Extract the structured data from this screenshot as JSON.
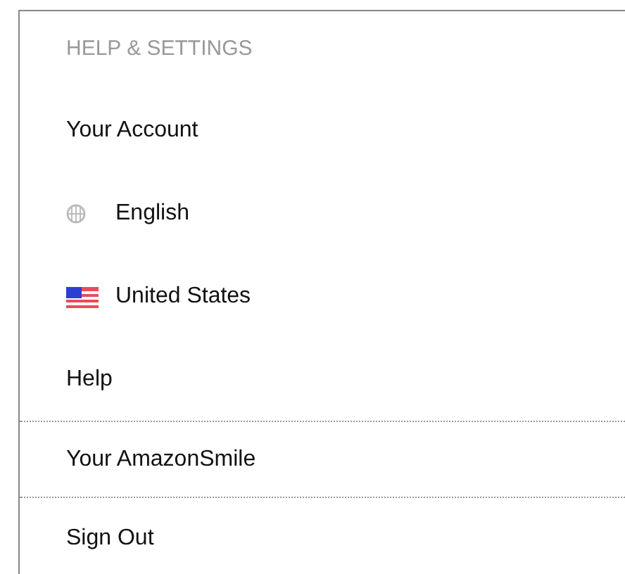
{
  "heading": "HELP & SETTINGS",
  "items": [
    {
      "kind": "text",
      "label": "Your Account",
      "divider_below": false
    },
    {
      "kind": "globe",
      "label": "English",
      "divider_below": false
    },
    {
      "kind": "flag",
      "label": "United States",
      "divider_below": false
    },
    {
      "kind": "text",
      "label": "Help",
      "divider_below": true
    },
    {
      "kind": "text",
      "label": "Your AmazonSmile",
      "divider_below": true
    },
    {
      "kind": "text",
      "label": "Sign Out",
      "divider_below": false
    }
  ]
}
